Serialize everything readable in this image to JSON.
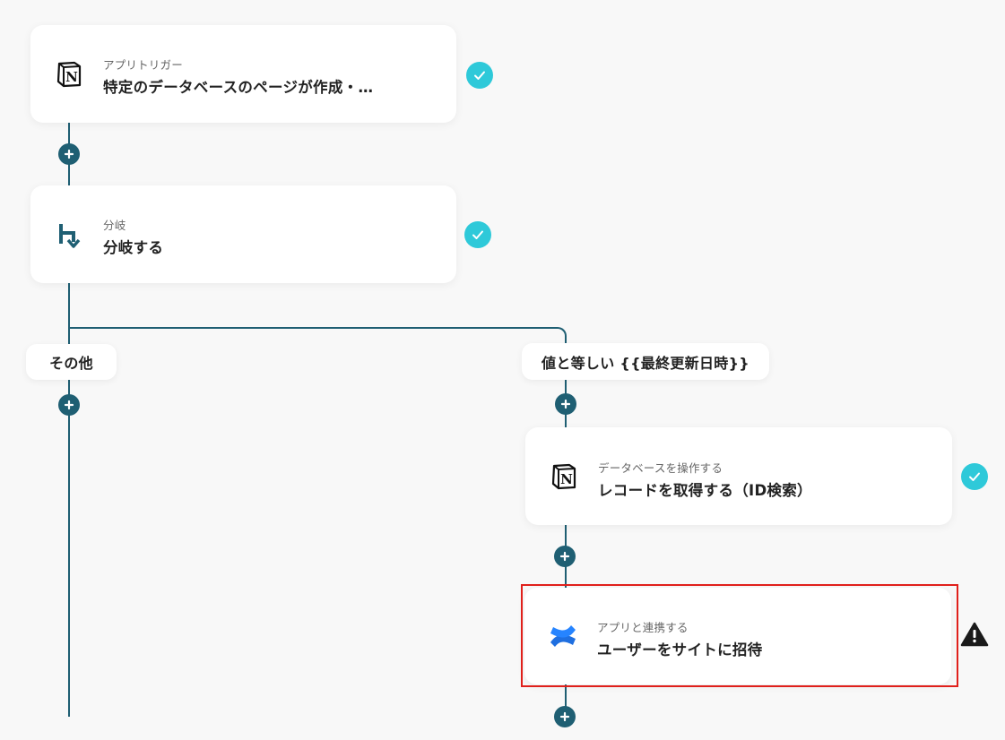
{
  "steps": [
    {
      "id": "trigger",
      "subtitle": "アプリトリガー",
      "title": "特定のデータベースのページが作成・…",
      "icon": "notion-icon",
      "status": "complete"
    },
    {
      "id": "branch",
      "subtitle": "分岐",
      "title": "分岐する",
      "icon": "branch-icon",
      "status": "complete"
    },
    {
      "id": "get-record",
      "subtitle": "データベースを操作する",
      "title": "レコードを取得する（ID検索）",
      "icon": "notion-icon",
      "status": "complete"
    },
    {
      "id": "invite-user",
      "subtitle": "アプリと連携する",
      "title": "ユーザーをサイトに招待",
      "icon": "confluence-icon",
      "status": "warning"
    }
  ],
  "branches": {
    "other_label": "その他",
    "condition_label": "値と等しい {{最終更新日時}}"
  },
  "colors": {
    "line": "#1f5f73",
    "check": "#2ec9d9",
    "selection": "#e0201b"
  }
}
